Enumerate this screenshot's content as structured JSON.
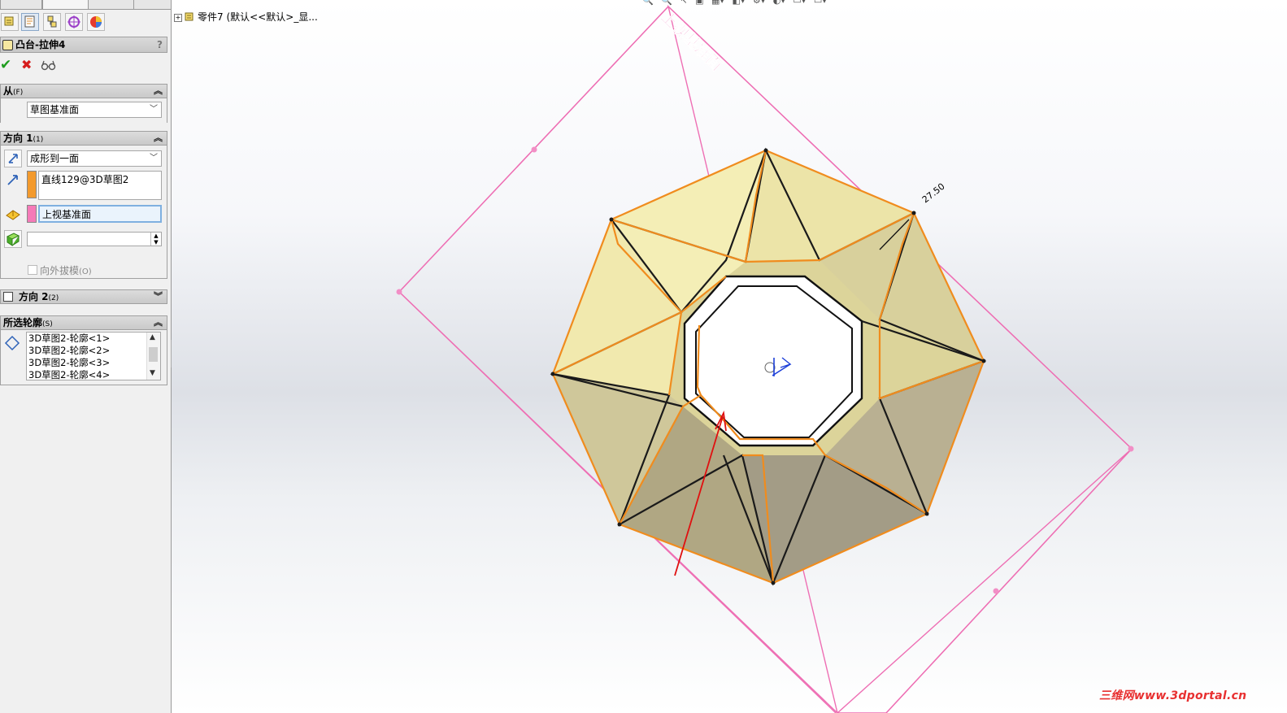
{
  "panel_tabs": {
    "icons": [
      "feature-manager-icon",
      "property-manager-icon",
      "configuration-manager-icon",
      "dimxpert-icon",
      "display-manager-icon"
    ]
  },
  "property_manager": {
    "title": "凸台-拉伸4",
    "help": "?",
    "ok_icon": "✔",
    "cancel_icon": "✖",
    "preview_icon": "66"
  },
  "from_section": {
    "title": "从",
    "shortcut": "(F)",
    "start_condition": "草图基准面"
  },
  "direction1": {
    "title": "方向 1",
    "shortcut": "(1)",
    "end_condition": "成形到一面",
    "direction_vector": "直线129@3D草图2",
    "face_plane": "上视基准面",
    "offset_value": "",
    "draft_outward_label": "向外拔模",
    "draft_outward_shortcut": "(O)"
  },
  "direction2": {
    "title": "方向 2",
    "shortcut": "(2)"
  },
  "selected_contours": {
    "title": "所选轮廓",
    "shortcut": "(S)",
    "items": [
      "3D草图2-轮廓<1>",
      "3D草图2-轮廓<2>",
      "3D草图2-轮廓<3>",
      "3D草图2-轮廓<4>"
    ]
  },
  "feature_tree": {
    "part_label": "零件7",
    "config_label": "(默认<<默认>_显..."
  },
  "viewport": {
    "plane_label": "上视基准面",
    "dimension_label": "27.50",
    "watermark": "三维网www.3dportal.cn"
  },
  "colors": {
    "plane": "#ee6fb4",
    "edge_highlight": "#f08c1e",
    "face_light": "#efe9a8",
    "face_dark": "#a9a07a",
    "annotation_arrow": "#e01010",
    "accept": "#1f9d1f",
    "cancel": "#d61d1d"
  }
}
